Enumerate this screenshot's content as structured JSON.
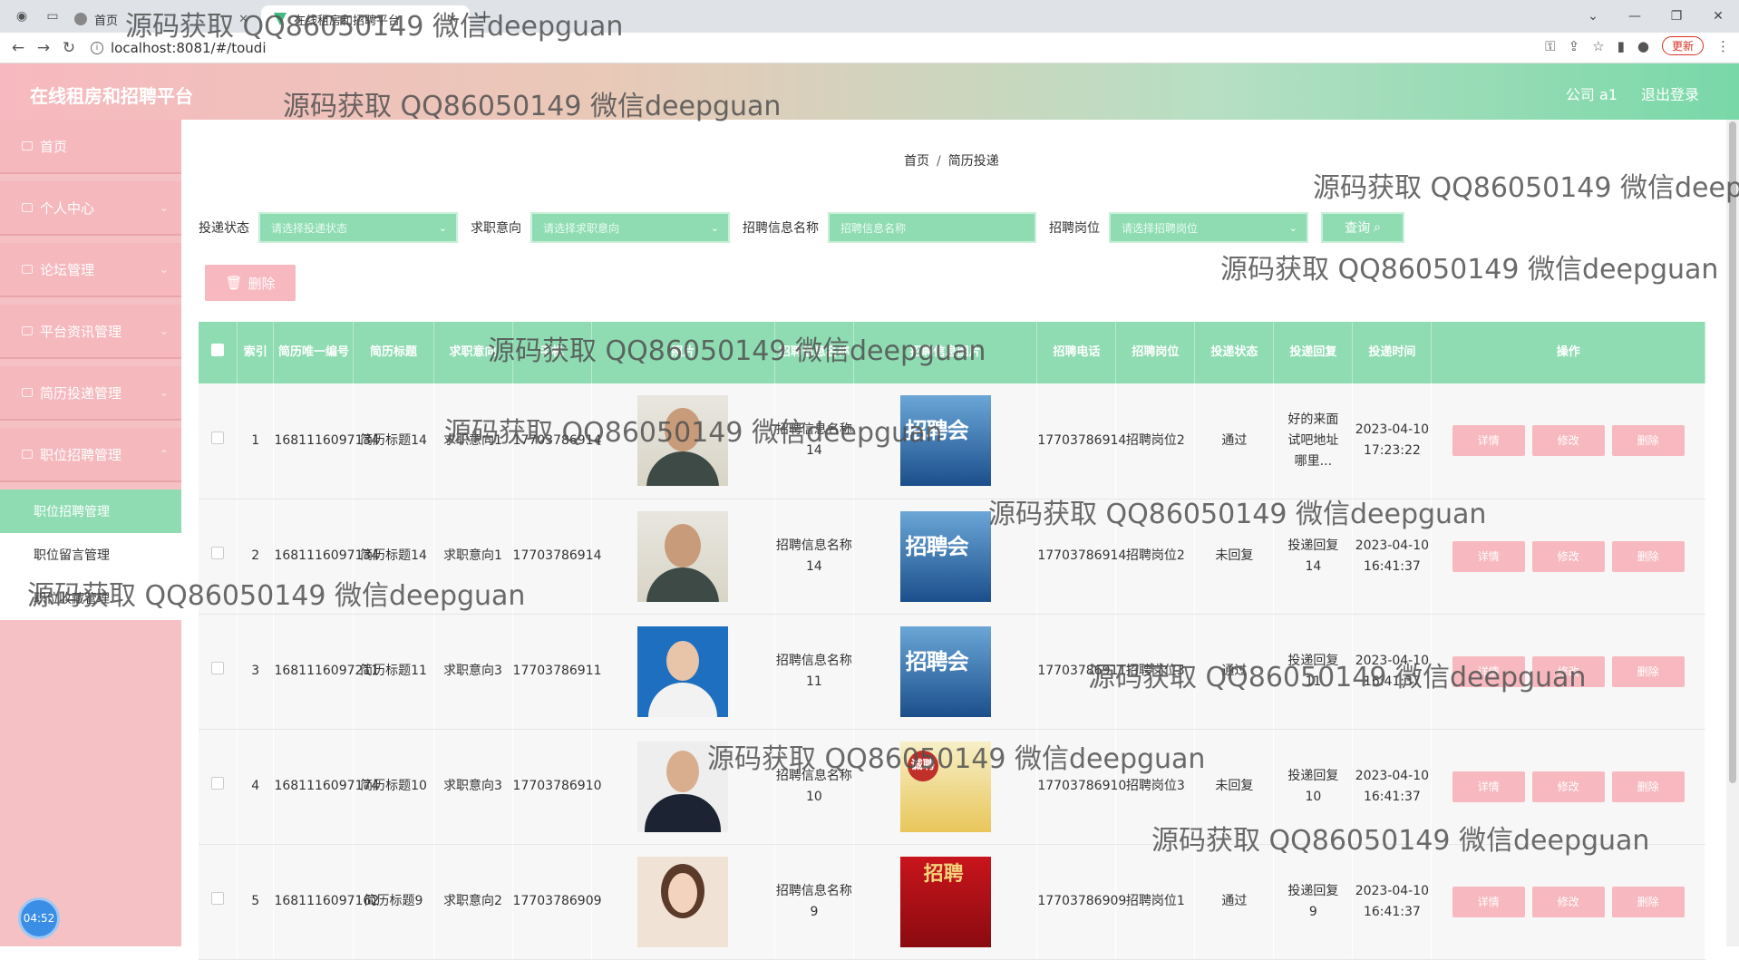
{
  "browser": {
    "tabs": [
      {
        "title": "首页"
      },
      {
        "title": "在线租房和招聘平台"
      }
    ],
    "url": "localhost:8081/#/toudi",
    "update_label": "更新"
  },
  "header": {
    "title": "在线租房和招聘平台",
    "company": "公司 a1",
    "logout": "退出登录"
  },
  "sidebar": {
    "items": [
      {
        "label": "首页"
      },
      {
        "label": "个人中心"
      },
      {
        "label": "论坛管理"
      },
      {
        "label": "平台资讯管理"
      },
      {
        "label": "简历投递管理"
      },
      {
        "label": "职位招聘管理"
      }
    ],
    "sub_items": [
      {
        "label": "职位招聘管理"
      },
      {
        "label": "职位留言管理"
      },
      {
        "label": "职位收藏管理"
      }
    ],
    "timer": "04:52"
  },
  "breadcrumb": {
    "home": "首页",
    "sep": "/",
    "current": "简历投递"
  },
  "filters": {
    "status_label": "投递状态",
    "status_placeholder": "请选择投递状态",
    "intent_label": "求职意向",
    "intent_placeholder": "请选择求职意向",
    "name_label": "招聘信息名称",
    "name_placeholder": "招聘信息名称",
    "position_label": "招聘岗位",
    "position_placeholder": "请选择招聘岗位",
    "query_label": "查询"
  },
  "delete_button": "删除",
  "table": {
    "headers": [
      "索引",
      "简历唯一编号",
      "简历标题",
      "求职意向",
      "手机",
      "照片",
      "招聘信息名称",
      "招聘信息图片",
      "招聘电话",
      "招聘岗位",
      "投递状态",
      "投递回复",
      "投递时间",
      "操作"
    ],
    "actions": {
      "detail": "详情",
      "edit": "修改",
      "delete": "删除"
    },
    "rows": [
      {
        "idx": "1",
        "resume_no": "1681116097134",
        "title": "简历标题14",
        "intent": "求职意向1",
        "phone": "17703786914",
        "job_name": "招聘信息名称14",
        "job_phone": "17703786914",
        "position": "招聘岗位2",
        "status": "通过",
        "reply": "好的来面试吧地址哪里...",
        "time": "2023-04-10 17:23:22"
      },
      {
        "idx": "2",
        "resume_no": "1681116097134",
        "title": "简历标题14",
        "intent": "求职意向1",
        "phone": "17703786914",
        "job_name": "招聘信息名称14",
        "job_phone": "17703786914",
        "position": "招聘岗位2",
        "status": "未回复",
        "reply": "投递回复14",
        "time": "2023-04-10 16:41:37"
      },
      {
        "idx": "3",
        "resume_no": "1681116097211",
        "title": "简历标题11",
        "intent": "求职意向3",
        "phone": "17703786911",
        "job_name": "招聘信息名称11",
        "job_phone": "17703786911",
        "position": "招聘岗位3",
        "status": "通过",
        "reply": "投递回复11",
        "time": "2023-04-10 16:41:37"
      },
      {
        "idx": "4",
        "resume_no": "1681116097174",
        "title": "简历标题10",
        "intent": "求职意向3",
        "phone": "17703786910",
        "job_name": "招聘信息名称10",
        "job_phone": "17703786910",
        "position": "招聘岗位3",
        "status": "未回复",
        "reply": "投递回复10",
        "time": "2023-04-10 16:41:37"
      },
      {
        "idx": "5",
        "resume_no": "1681116097162",
        "title": "简历标题9",
        "intent": "求职意向2",
        "phone": "17703786909",
        "job_name": "招聘信息名称9",
        "job_phone": "17703786909",
        "position": "招聘岗位1",
        "status": "通过",
        "reply": "投递回复9",
        "time": "2023-04-10 16:41:37"
      }
    ]
  },
  "watermark": "源码获取 QQ86050149 微信deepguan"
}
